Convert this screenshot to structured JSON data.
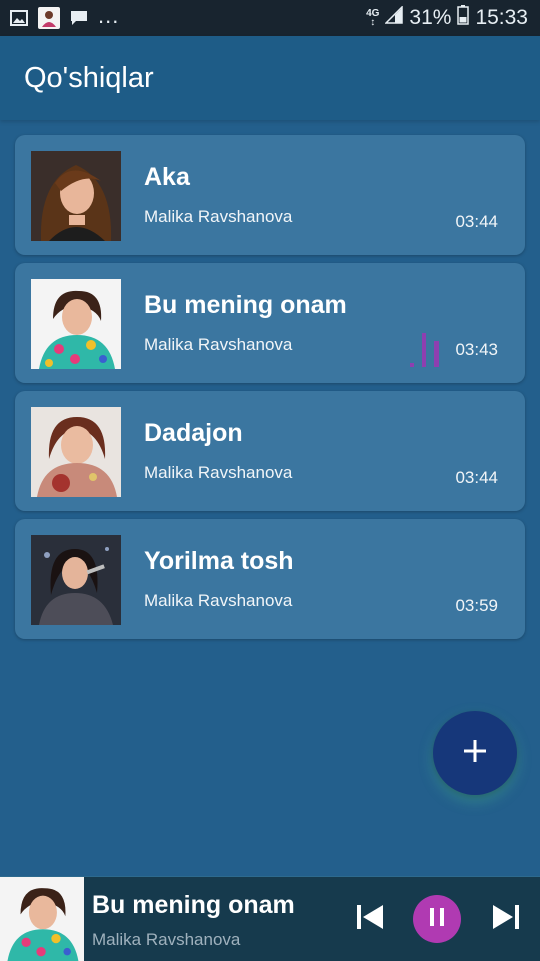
{
  "status_bar": {
    "battery": "31%",
    "time": "15:33",
    "network": "4G",
    "more": "..."
  },
  "app_bar": {
    "title": "Qo'shiqlar"
  },
  "songs": [
    {
      "title": "Aka",
      "artist": "Malika Ravshanova",
      "duration": "03:44",
      "playing": false
    },
    {
      "title": "Bu mening onam",
      "artist": "Malika Ravshanova",
      "duration": "03:43",
      "playing": true
    },
    {
      "title": "Dadajon",
      "artist": "Malika Ravshanova",
      "duration": "03:44",
      "playing": false
    },
    {
      "title": "Yorilma tosh",
      "artist": "Malika Ravshanova",
      "duration": "03:59",
      "playing": false
    }
  ],
  "fab": {
    "icon": "plus-icon"
  },
  "now_playing": {
    "title": "Bu mening onam",
    "artist": "Malika Ravshanova",
    "controls": [
      "previous-icon",
      "pause-icon",
      "next-icon"
    ]
  },
  "colors": {
    "background": "#235f8c",
    "card": "#3b76a0",
    "fab": "#16377a",
    "pause_button": "#b03ab2",
    "equalizer": "#8e3fb0"
  }
}
